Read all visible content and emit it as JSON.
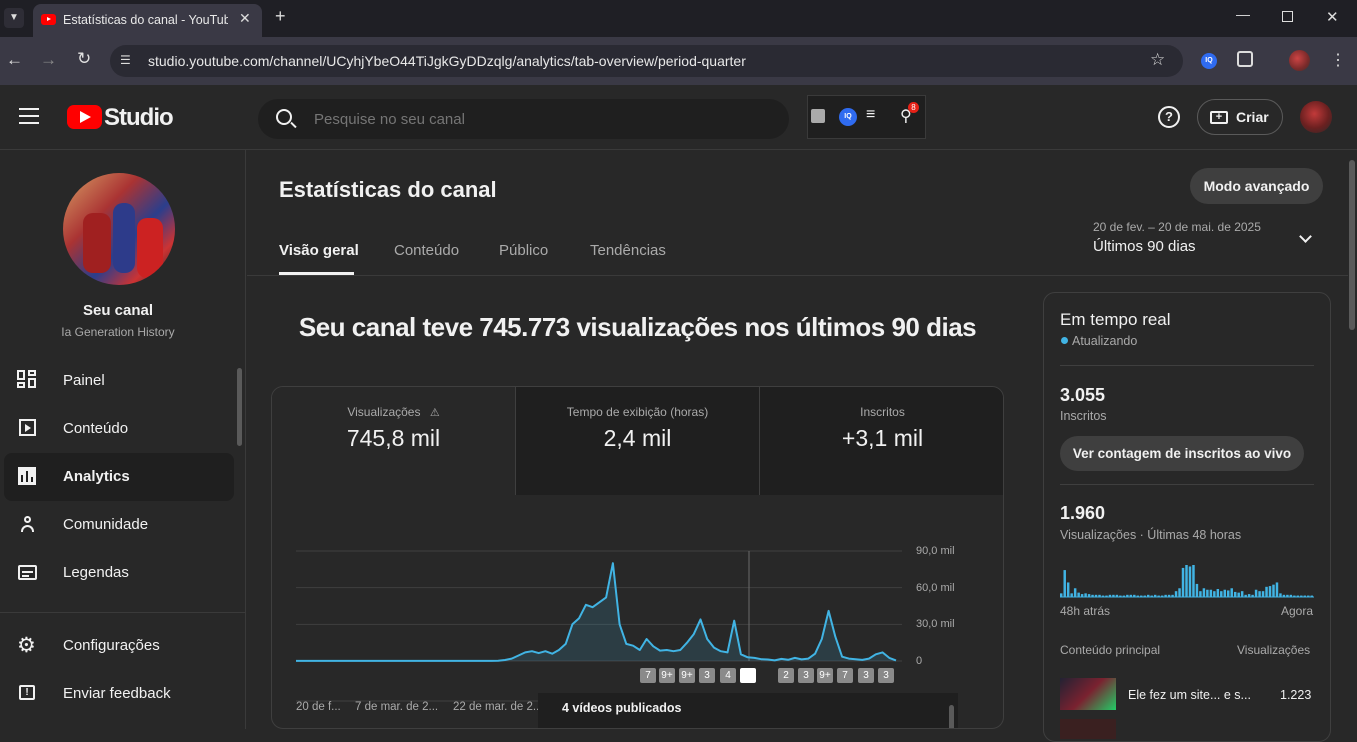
{
  "browser": {
    "tab_title": "Estatísticas do canal - YouTube",
    "url": "studio.youtube.com/channel/UCyhjYbeO44TiJgkGyDDzqlg/analytics/tab-overview/period-quarter"
  },
  "header": {
    "logo_text": "Studio",
    "search_placeholder": "Pesquise no seu canal",
    "notification_count": "8",
    "create_label": "Criar"
  },
  "sidebar": {
    "channel_title": "Seu canal",
    "channel_name": "Ia Generation History",
    "items": [
      {
        "label": "Painel",
        "icon": "dashboard-icon"
      },
      {
        "label": "Conteúdo",
        "icon": "content-icon"
      },
      {
        "label": "Analytics",
        "icon": "analytics-icon",
        "active": true
      },
      {
        "label": "Comunidade",
        "icon": "community-icon"
      },
      {
        "label": "Legendas",
        "icon": "subtitles-icon"
      }
    ],
    "settings_label": "Configurações",
    "feedback_label": "Enviar feedback"
  },
  "page": {
    "title": "Estatísticas do canal",
    "advanced_mode": "Modo avançado",
    "date_range": "20 de fev. – 20 de mai. de 2025",
    "period_label": "Últimos 90 dias",
    "tabs": [
      "Visão geral",
      "Conteúdo",
      "Público",
      "Tendências"
    ],
    "headline": "Seu canal teve 745.773 visualizações nos últimos 90 dias"
  },
  "metrics": [
    {
      "title": "Visualizações",
      "value": "745,8 mil"
    },
    {
      "title": "Tempo de exibição (horas)",
      "value": "2,4 mil"
    },
    {
      "title": "Inscritos",
      "value": "+3,1 mil"
    }
  ],
  "chart": {
    "y_ticks": [
      "90,0 mil",
      "60,0 mil",
      "30,0 mil",
      "0"
    ],
    "x_ticks": [
      "20 de f...",
      "7 de mar. de 2...",
      "22 de mar. de 2..."
    ],
    "badges": [
      "7",
      "9+",
      "9+",
      "3",
      "4",
      "",
      "2",
      "3",
      "9+",
      "7",
      "3",
      "3"
    ],
    "published_label": "4 vídeos publicados"
  },
  "chart_data": {
    "type": "area",
    "title": "",
    "ylabel": "",
    "ylim": [
      0,
      90000
    ],
    "series": [
      {
        "values": [
          100,
          100,
          100,
          100,
          100,
          100,
          100,
          100,
          100,
          100,
          100,
          100,
          100,
          100,
          100,
          100,
          100,
          100,
          100,
          100,
          100,
          100,
          100,
          100,
          100,
          100,
          100,
          100,
          100,
          100,
          200,
          800,
          2000,
          4500,
          7000,
          8000,
          6500,
          8000,
          6000,
          9000,
          14000,
          30000,
          35000,
          46000,
          44000,
          48000,
          52000,
          80000,
          30000,
          14000,
          12500,
          9000,
          18000,
          12000,
          8500,
          9000,
          8000,
          9000,
          15000,
          22000,
          34000,
          18000,
          11000,
          8000,
          7000,
          33000,
          5500,
          3000,
          2500,
          1500,
          1200,
          500,
          1700,
          1000,
          2500,
          1300,
          2000,
          6000,
          18000,
          41000,
          20000,
          3500,
          2000,
          1500,
          900,
          2000,
          5500,
          7000,
          2500,
          500
        ]
      }
    ]
  },
  "realtime": {
    "title": "Em tempo real",
    "updating": "Atualizando",
    "subscribers_value": "3.055",
    "subscribers_label": "Inscritos",
    "live_count_button": "Ver contagem de inscritos ao vivo",
    "views_value": "1.960",
    "views_label": "Visualizações · Últimas 48 horas",
    "axis_left": "48h atrás",
    "axis_right": "Agora",
    "top_content_label": "Conteúdo principal",
    "top_views_label": "Visualizações",
    "top_item_title": "Ele fez um site... e s...",
    "top_item_views": "1.223",
    "bars": [
      5,
      37,
      20,
      5,
      12,
      6,
      4,
      5,
      4,
      3,
      3,
      3,
      2,
      2,
      3,
      3,
      3,
      2,
      2,
      3,
      3,
      3,
      2,
      2,
      2,
      3,
      2,
      3,
      2,
      2,
      3,
      3,
      3,
      8,
      12,
      40,
      44,
      42,
      44,
      18,
      8,
      12,
      10,
      10,
      8,
      11,
      8,
      10,
      9,
      12,
      7,
      6,
      8,
      3,
      4,
      3,
      10,
      8,
      8,
      14,
      15,
      17,
      20,
      5,
      3,
      3,
      3,
      2,
      2,
      2,
      2,
      2,
      2
    ]
  }
}
